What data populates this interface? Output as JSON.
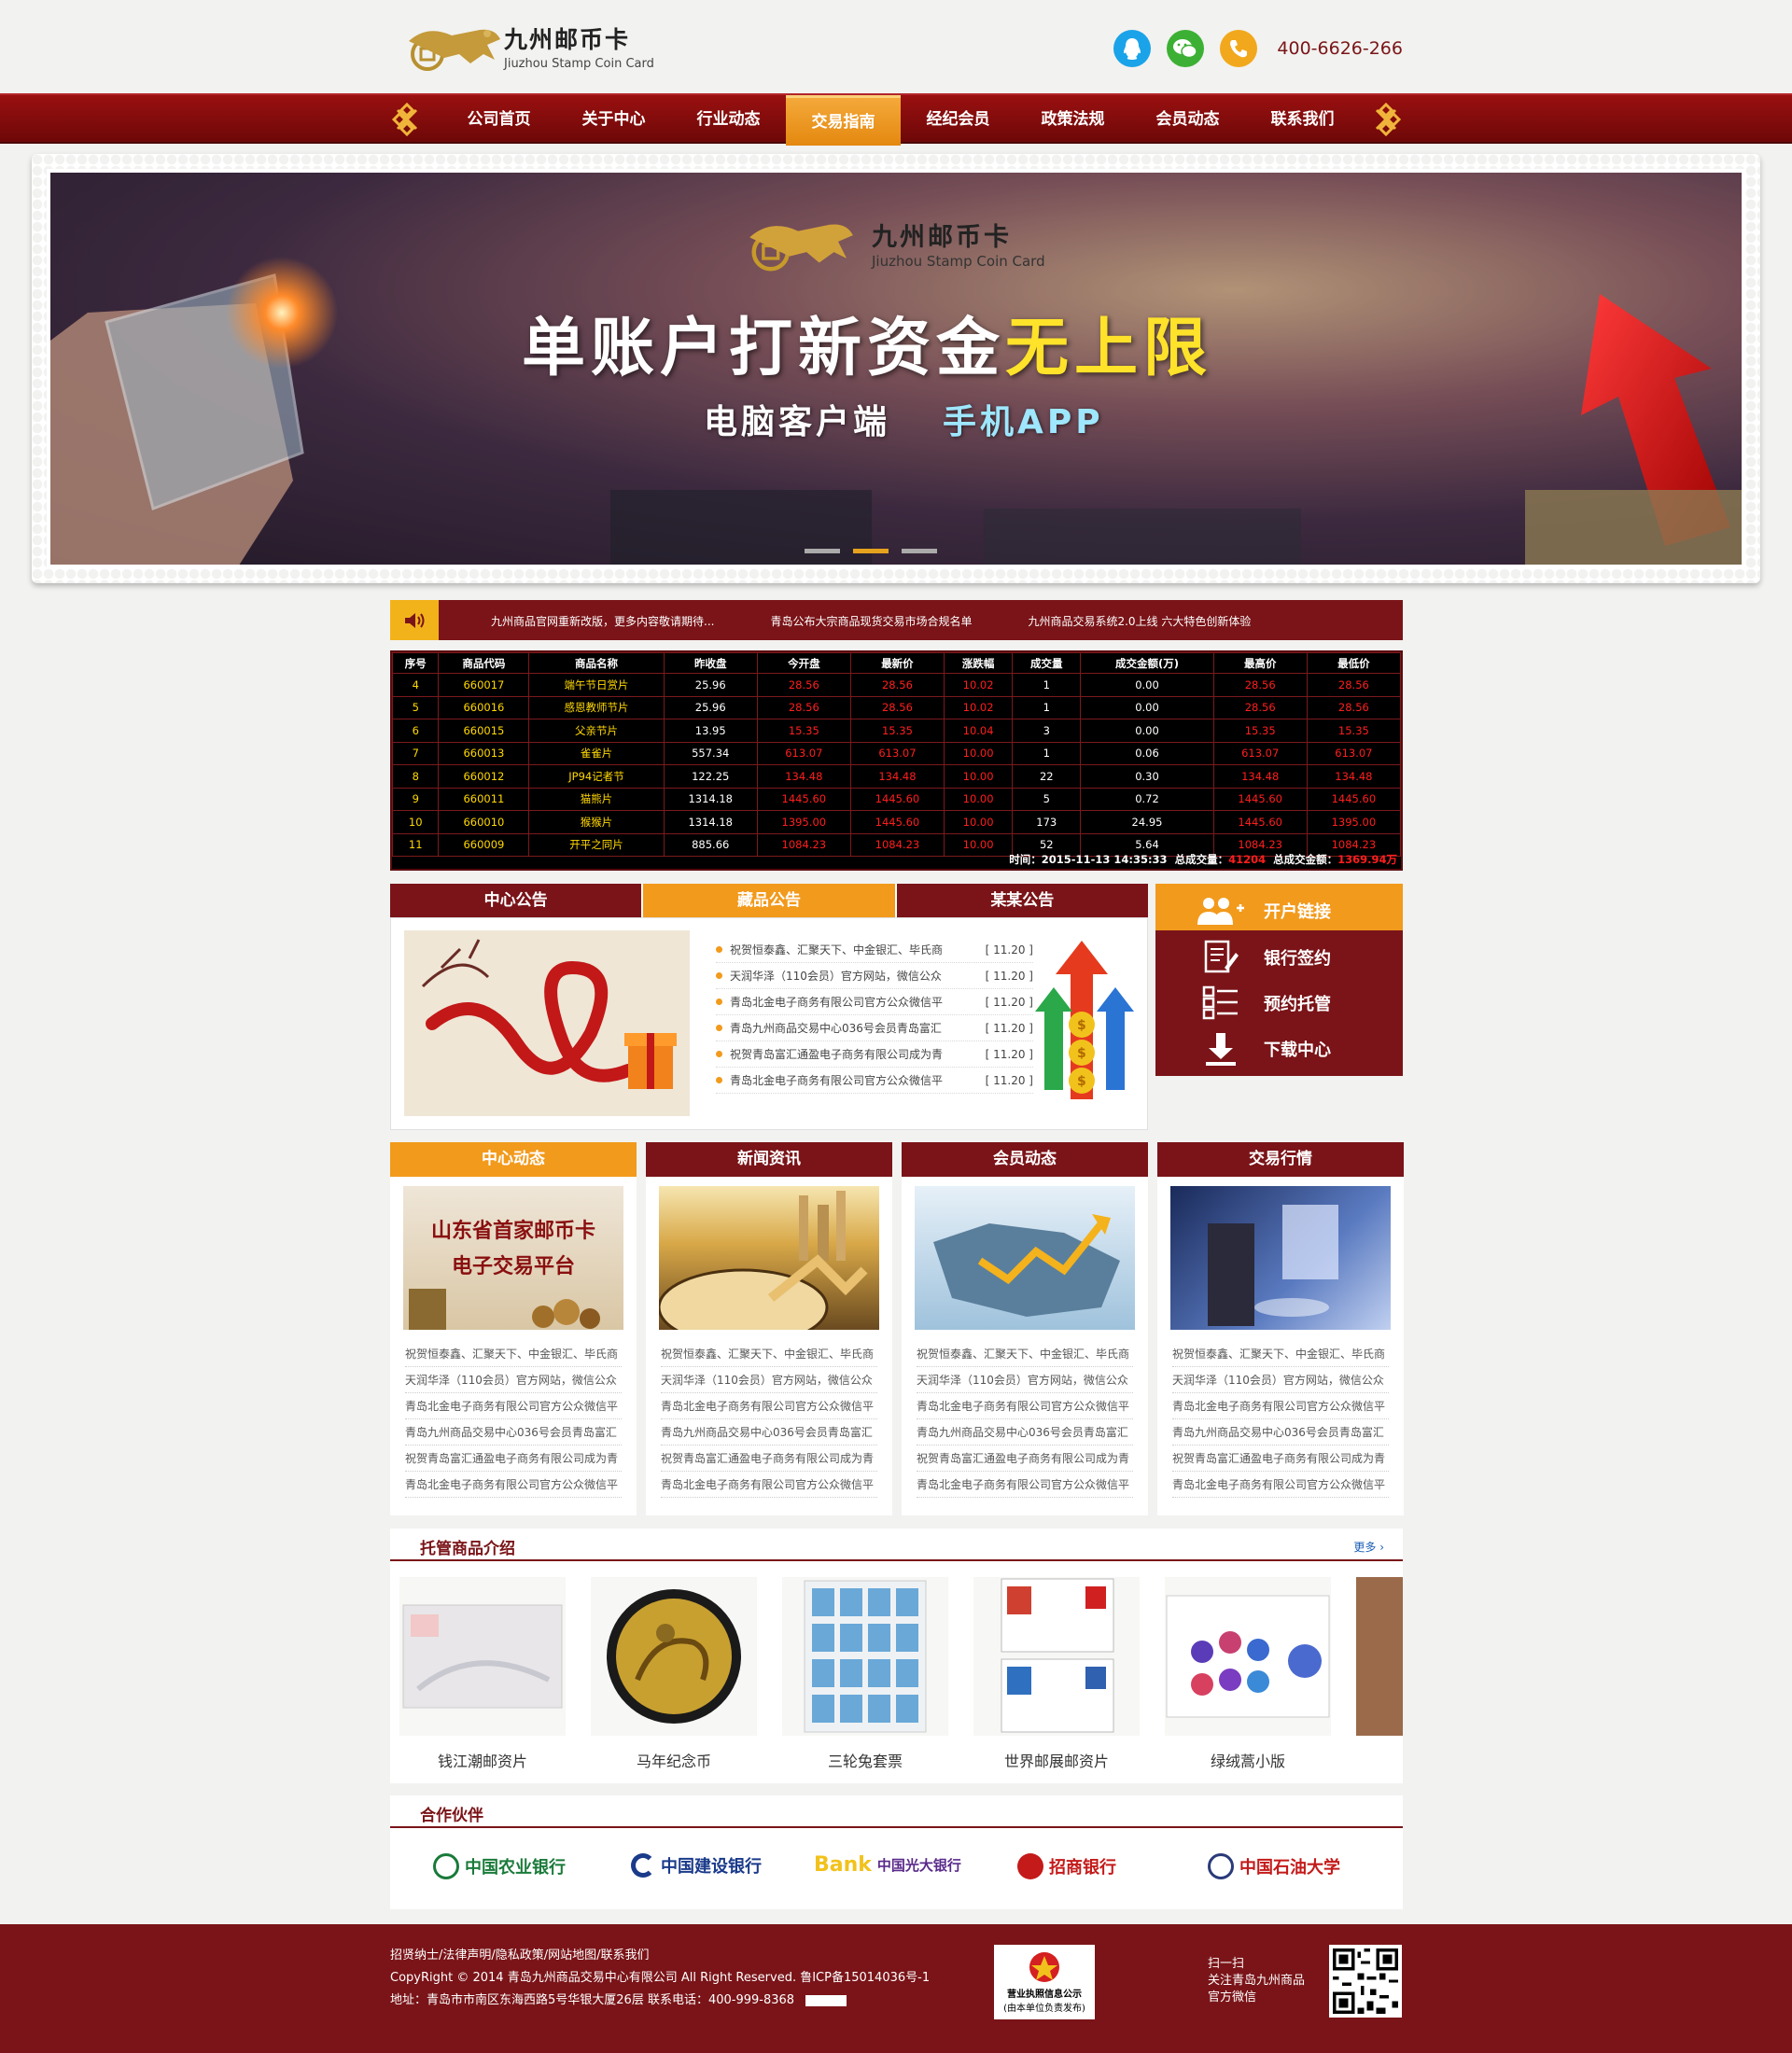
{
  "brand": {
    "name_cn": "九州邮币卡",
    "name_en": "Jiuzhou Stamp Coin Card",
    "phone": "400-6626-266"
  },
  "colors": {
    "primary": "#7a1418",
    "accent": "#f29a1c",
    "qq": "#1aa3e8",
    "wechat": "#3cb034",
    "phone_icon": "#f2a81c"
  },
  "header_icons": [
    "qq-icon",
    "wechat-icon",
    "phone-icon"
  ],
  "nav": {
    "items": [
      {
        "label": "公司首页",
        "active": false
      },
      {
        "label": "关于中心",
        "active": false
      },
      {
        "label": "行业动态",
        "active": false
      },
      {
        "label": "交易指南",
        "active": true
      },
      {
        "label": "经纪会员",
        "active": false
      },
      {
        "label": "政策法规",
        "active": false
      },
      {
        "label": "会员动态",
        "active": false
      },
      {
        "label": "联系我们",
        "active": false
      }
    ]
  },
  "banner": {
    "brand_cn": "九州邮币卡",
    "brand_en": "Jiuzhou Stamp Coin Card",
    "title_main": "单账户打新资金",
    "title_highlight": "无上限",
    "sub_left": "电脑客户端",
    "sub_right": "手机APP",
    "slides": 3,
    "active_slide": 2
  },
  "ticker": {
    "items": [
      "九州商品官网重新改版，更多内容敬请期待...",
      "青岛公布大宗商品现货交易市场合规名单",
      "九州商品交易系统2.0上线 六大特色创新体验"
    ]
  },
  "quotes": {
    "headers": [
      "序号",
      "商品代码",
      "商品名称",
      "昨收盘",
      "今开盘",
      "最新价",
      "涨跌幅",
      "成交量",
      "成交金额(万)",
      "最高价",
      "最低价"
    ],
    "rows": [
      [
        "4",
        "660017",
        "端午节日赏片",
        "25.96",
        "28.56",
        "28.56",
        "10.02",
        "1",
        "0.00",
        "28.56",
        "28.56"
      ],
      [
        "5",
        "660016",
        "感恩教师节片",
        "25.96",
        "28.56",
        "28.56",
        "10.02",
        "1",
        "0.00",
        "28.56",
        "28.56"
      ],
      [
        "6",
        "660015",
        "父亲节片",
        "13.95",
        "15.35",
        "15.35",
        "10.04",
        "3",
        "0.00",
        "15.35",
        "15.35"
      ],
      [
        "7",
        "660013",
        "雀雀片",
        "557.34",
        "613.07",
        "613.07",
        "10.00",
        "1",
        "0.06",
        "613.07",
        "613.07"
      ],
      [
        "8",
        "660012",
        "JP94记者节",
        "122.25",
        "134.48",
        "134.48",
        "10.00",
        "22",
        "0.30",
        "134.48",
        "134.48"
      ],
      [
        "9",
        "660011",
        "猫熊片",
        "1314.18",
        "1445.60",
        "1445.60",
        "10.00",
        "5",
        "0.72",
        "1445.60",
        "1445.60"
      ],
      [
        "10",
        "660010",
        "猴猴片",
        "1314.18",
        "1395.00",
        "1445.60",
        "10.00",
        "173",
        "24.95",
        "1445.60",
        "1395.00"
      ],
      [
        "11",
        "660009",
        "开平之同片",
        "885.66",
        "1084.23",
        "1084.23",
        "10.00",
        "52",
        "5.64",
        "1084.23",
        "1084.23"
      ]
    ],
    "footer_time_label": "时间：",
    "footer_time": "2015-11-13 14:35:33",
    "footer_vol_label": "总成交量：",
    "footer_vol": "41204",
    "footer_amt_label": "总成交金额：",
    "footer_amt": "1369.94万"
  },
  "notice": {
    "tabs": [
      {
        "label": "中心公告",
        "active": false
      },
      {
        "label": "藏品公告",
        "active": true
      },
      {
        "label": "某某公告",
        "active": false
      }
    ],
    "items": [
      {
        "text": "祝贺恒泰鑫、汇聚天下、中金银汇、毕氏商",
        "date": "[ 11.20 ]"
      },
      {
        "text": "天润华泽（110会员）官方网站，微信公众",
        "date": "[ 11.20 ]"
      },
      {
        "text": "青岛北金电子商务有限公司官方公众微信平",
        "date": "[ 11.20 ]"
      },
      {
        "text": "青岛九州商品交易中心036号会员青岛富汇",
        "date": "[ 11.20 ]"
      },
      {
        "text": "祝贺青岛富汇通盈电子商务有限公司成为青",
        "date": "[ 11.20 ]"
      },
      {
        "text": "青岛北金电子商务有限公司官方公众微信平",
        "date": "[ 11.20 ]"
      }
    ]
  },
  "side_buttons": [
    {
      "label": "开户链接",
      "icon": "users-add-icon",
      "active": true
    },
    {
      "label": "银行签约",
      "icon": "sign-document-icon",
      "active": false
    },
    {
      "label": "预约托管",
      "icon": "list-icon",
      "active": false
    },
    {
      "label": "下载中心",
      "icon": "download-icon",
      "active": false
    }
  ],
  "columns": [
    {
      "title": "中心动态",
      "active": true,
      "img_text_1": "山东省首家邮币卡",
      "img_text_2": "电子交易平台"
    },
    {
      "title": "新闻资讯",
      "active": false
    },
    {
      "title": "会员动态",
      "active": false
    },
    {
      "title": "交易行情",
      "active": false
    }
  ],
  "column_items": [
    "祝贺恒泰鑫、汇聚天下、中金银汇、毕氏商",
    "天润华泽（110会员）官方网站，微信公众",
    "青岛北金电子商务有限公司官方公众微信平",
    "青岛九州商品交易中心036号会员青岛富汇",
    "祝贺青岛富汇通盈电子商务有限公司成为青",
    "青岛北金电子商务有限公司官方公众微信平"
  ],
  "products": {
    "title": "托管商品介绍",
    "more": "更多",
    "items": [
      {
        "name": "钱江潮邮资片"
      },
      {
        "name": "马年纪念币"
      },
      {
        "name": "三轮兔套票"
      },
      {
        "name": "世界邮展邮资片"
      },
      {
        "name": "绿绒蒿小版"
      }
    ]
  },
  "partners": {
    "title": "合作伙伴",
    "items": [
      "中国农业银行",
      "中国建设银行",
      "中国光大银行",
      "招商银行",
      "中国石油大学"
    ]
  },
  "footer": {
    "links": "招贤纳士/法律声明/隐私政策/网站地图/联系我们",
    "copyright": "CopyRight © 2014  青岛九州商品交易中心有限公司  All Right Reserved.    鲁ICP备15014036号-1",
    "address": "地址：青岛市市南区东海西路5号华银大厦26层        联系电话：400-999-8368",
    "license_line1": "营业执照信息公示",
    "license_line2": "(由本单位负责发布)",
    "qr_line1": "扫一扫",
    "qr_line2": "关注青岛九州商品",
    "qr_line3": "官方微信"
  }
}
